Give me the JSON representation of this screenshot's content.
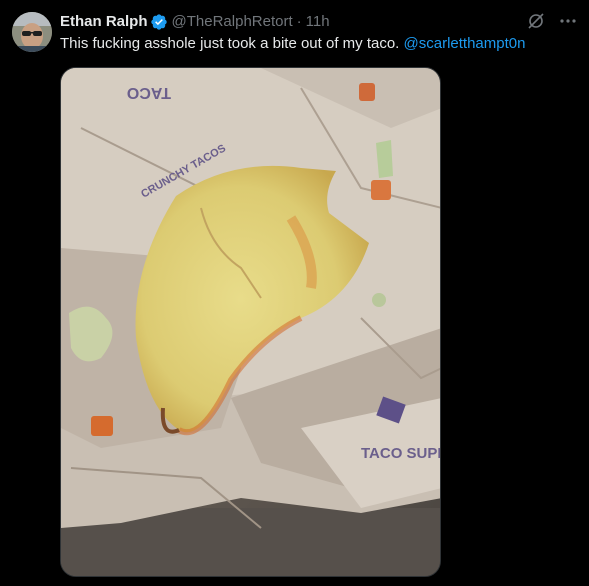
{
  "tweet": {
    "author": {
      "display_name": "Ethan Ralph",
      "handle": "@TheRalphRetort",
      "verified": true,
      "verified_color": "#1d9bf0"
    },
    "separator": "·",
    "time": "11h",
    "text_before": "This fucking asshole just took a bite out of my taco. ",
    "mention": "@scarletthampt0n",
    "media": {
      "wrapper_texts": [
        "TACO",
        "CRUNCHY TACOS",
        "TACO SUPREME"
      ],
      "icon": "photo-of-bitten-taco-on-wrapper"
    },
    "icons": {
      "grok": "grok-icon",
      "more": "more-options-icon"
    },
    "colors": {
      "background": "#000000",
      "text": "#e7e9ea",
      "secondary": "#71767b",
      "link": "#1d9bf0"
    }
  }
}
